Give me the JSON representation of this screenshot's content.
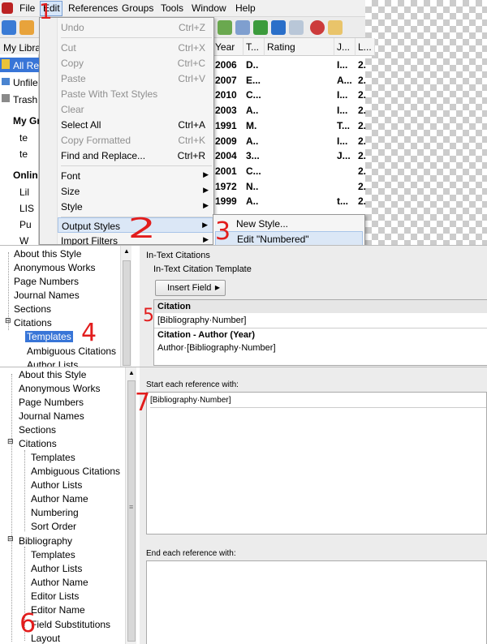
{
  "menubar": {
    "items": [
      "File",
      "Edit",
      "References",
      "Groups",
      "Tools",
      "Window",
      "Help"
    ]
  },
  "left_pane": {
    "header": "My Libra",
    "items": [
      "All Re",
      "Unfile",
      "Trash",
      "My Gr",
      "te",
      "te",
      "Onlin",
      "Lil",
      "LIS",
      "Pu",
      "W"
    ]
  },
  "grid": {
    "columns": [
      "Year",
      "T...",
      "Rating",
      "J...",
      "L..."
    ],
    "rows": [
      {
        "year": "2006",
        "t": "D..",
        "j": "I...",
        "l": "2."
      },
      {
        "year": "2007",
        "t": "E...",
        "j": "A...",
        "l": "2."
      },
      {
        "year": "2010",
        "t": "C...",
        "j": "I...",
        "l": "2."
      },
      {
        "year": "2003",
        "t": "A..",
        "j": "I...",
        "l": "2."
      },
      {
        "year": "1991",
        "t": "M.",
        "j": "T...",
        "l": "2."
      },
      {
        "year": "2009",
        "t": "A..",
        "j": "I...",
        "l": "2."
      },
      {
        "year": "2004",
        "t": "3...",
        "j": "J...",
        "l": "2."
      },
      {
        "year": "2001",
        "t": "C...",
        "j": "",
        "l": "2."
      },
      {
        "year": "1972",
        "t": "N..",
        "j": "",
        "l": "2."
      },
      {
        "year": "1999",
        "t": "A..",
        "j": "t...",
        "l": "2."
      }
    ]
  },
  "edit_menu": {
    "items": [
      {
        "label": "Undo",
        "shortcut": "Ctrl+Z"
      },
      {
        "label": "Cut",
        "shortcut": "Ctrl+X"
      },
      {
        "label": "Copy",
        "shortcut": "Ctrl+C"
      },
      {
        "label": "Paste",
        "shortcut": "Ctrl+V"
      },
      {
        "label": "Paste With Text Styles",
        "shortcut": ""
      },
      {
        "label": "Clear",
        "shortcut": ""
      },
      {
        "label": "Select All",
        "shortcut": "Ctrl+A"
      },
      {
        "label": "Copy Formatted",
        "shortcut": "Ctrl+K"
      },
      {
        "label": "Find and Replace...",
        "shortcut": "Ctrl+R"
      },
      {
        "label": "Font",
        "shortcut": ""
      },
      {
        "label": "Size",
        "shortcut": ""
      },
      {
        "label": "Style",
        "shortcut": ""
      },
      {
        "label": "Output Styles",
        "shortcut": ""
      },
      {
        "label": "Import Filters",
        "shortcut": ""
      }
    ]
  },
  "output_styles_submenu": {
    "items": [
      "New Style...",
      "Edit \"Numbered\""
    ]
  },
  "annotations": {
    "n1": "1",
    "n2": "2",
    "n3": "3",
    "n4": "4",
    "n5": "5",
    "n6": "6",
    "n7": "7"
  },
  "style_editor_top": {
    "tree": [
      "About this Style",
      "Anonymous Works",
      "Page Numbers",
      "Journal Names",
      "Sections",
      "Citations",
      "Templates",
      "Ambiguous Citations",
      "Author Lists"
    ],
    "pane_title": "In-Text Citations",
    "section_label": "In-Text Citation Template",
    "insert_field": "Insert Field",
    "citation_heading": "Citation",
    "citation_template": "[Bibliography·Number]",
    "author_year_heading": "Citation - Author (Year)",
    "author_year_template": "Author·[Bibliography·Number]"
  },
  "style_editor_bottom": {
    "tree": [
      "About this Style",
      "Anonymous Works",
      "Page Numbers",
      "Journal Names",
      "Sections",
      "Citations",
      "Templates",
      "Ambiguous Citations",
      "Author Lists",
      "Author Name",
      "Numbering",
      "Sort Order",
      "Bibliography",
      "Templates",
      "Author Lists",
      "Author Name",
      "Editor Lists",
      "Editor Name",
      "Field Substitutions",
      "Layout"
    ],
    "start_label": "Start each reference with:",
    "start_value": "[Bibliography·Number]",
    "end_label": "End each reference with:"
  }
}
